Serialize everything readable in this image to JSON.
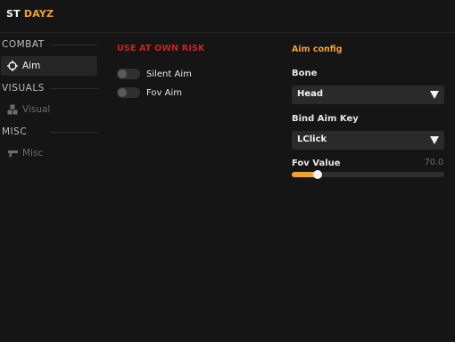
{
  "app": {
    "brand_prefix": "ST",
    "brand_suffix": "DAYZ"
  },
  "sidebar": {
    "sections": [
      {
        "title": "COMBAT",
        "items": [
          {
            "label": "Aim",
            "icon": "crosshair-icon",
            "active": true
          }
        ]
      },
      {
        "title": "VISUALS",
        "items": [
          {
            "label": "Visual",
            "icon": "cubes-icon",
            "active": false
          }
        ]
      },
      {
        "title": "MISC",
        "items": [
          {
            "label": "Misc",
            "icon": "gun-icon",
            "active": false
          }
        ]
      }
    ]
  },
  "main": {
    "warning": "USE AT OWN RISK",
    "toggles": [
      {
        "label": "Silent Aim",
        "on": false
      },
      {
        "label": "Fov Aim",
        "on": false
      }
    ],
    "config": {
      "title": "Aim config",
      "bone_label": "Bone",
      "bone_value": "Head",
      "bind_label": "Bind Aim Key",
      "bind_value": "LClick",
      "fov_label": "Fov Value",
      "fov_value": "70.0",
      "fov_fraction": 0.17
    }
  },
  "colors": {
    "accent": "#f0a030",
    "warning": "#cc2020",
    "background": "#151515",
    "panel": "#2a2a2a"
  }
}
